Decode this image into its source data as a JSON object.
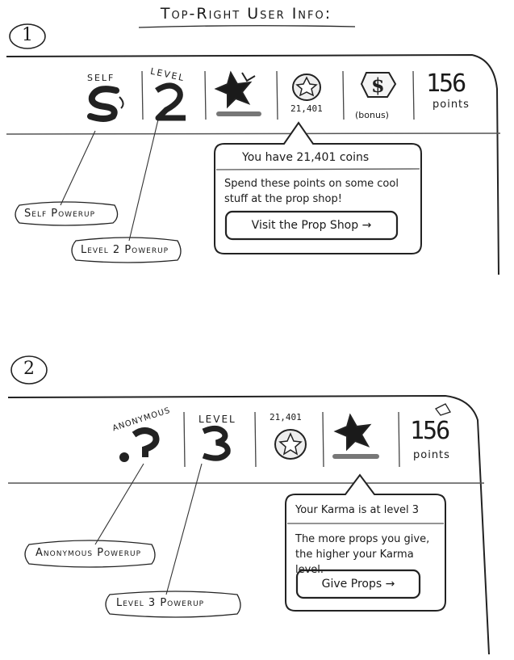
{
  "page": {
    "title": "Top-Right User Info:"
  },
  "sketch1": {
    "number": "1",
    "self_label": "SELF",
    "level_label": "LEVEL",
    "coins_value": "21,401",
    "bonus_label": "(bonus)",
    "points_value": "156",
    "points_label": "points",
    "popup": {
      "header": "You have 21,401 coins",
      "body": "Spend these points on some cool stuff at the prop shop!",
      "button": "Visit the Prop Shop →"
    },
    "callouts": {
      "self": "Self Powerup",
      "level": "Level 2 Powerup"
    }
  },
  "sketch2": {
    "number": "2",
    "anon_label": "ANONYMOUS",
    "level_label": "LEVEL",
    "coins_value": "21,401",
    "points_value": "156",
    "points_label": "points",
    "popup": {
      "header": "Your Karma is at level 3",
      "body": "The more props you give, the higher your Karma level.",
      "button": "Give Props →"
    },
    "callouts": {
      "anon": "Anonymous Powerup",
      "level": "Level 3 Powerup"
    }
  }
}
